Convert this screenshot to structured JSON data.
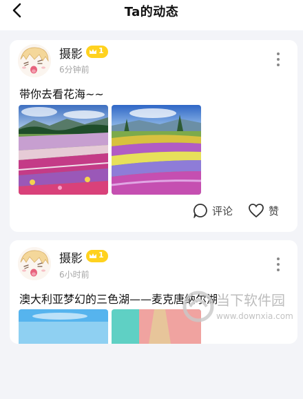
{
  "header": {
    "title": "Ta的动态"
  },
  "posts": [
    {
      "user": "摄影",
      "level": "1",
      "time": "6分钟前",
      "text": "带你去看花海~~",
      "actions": {
        "comment": "评论",
        "like": "赞"
      }
    },
    {
      "user": "摄影",
      "level": "1",
      "time": "6小时前",
      "text": "澳大利亚梦幻的三色湖——麦克唐纳尔湖"
    }
  ],
  "watermark": {
    "text": "当下软件园",
    "url": "www.downxia.com"
  }
}
